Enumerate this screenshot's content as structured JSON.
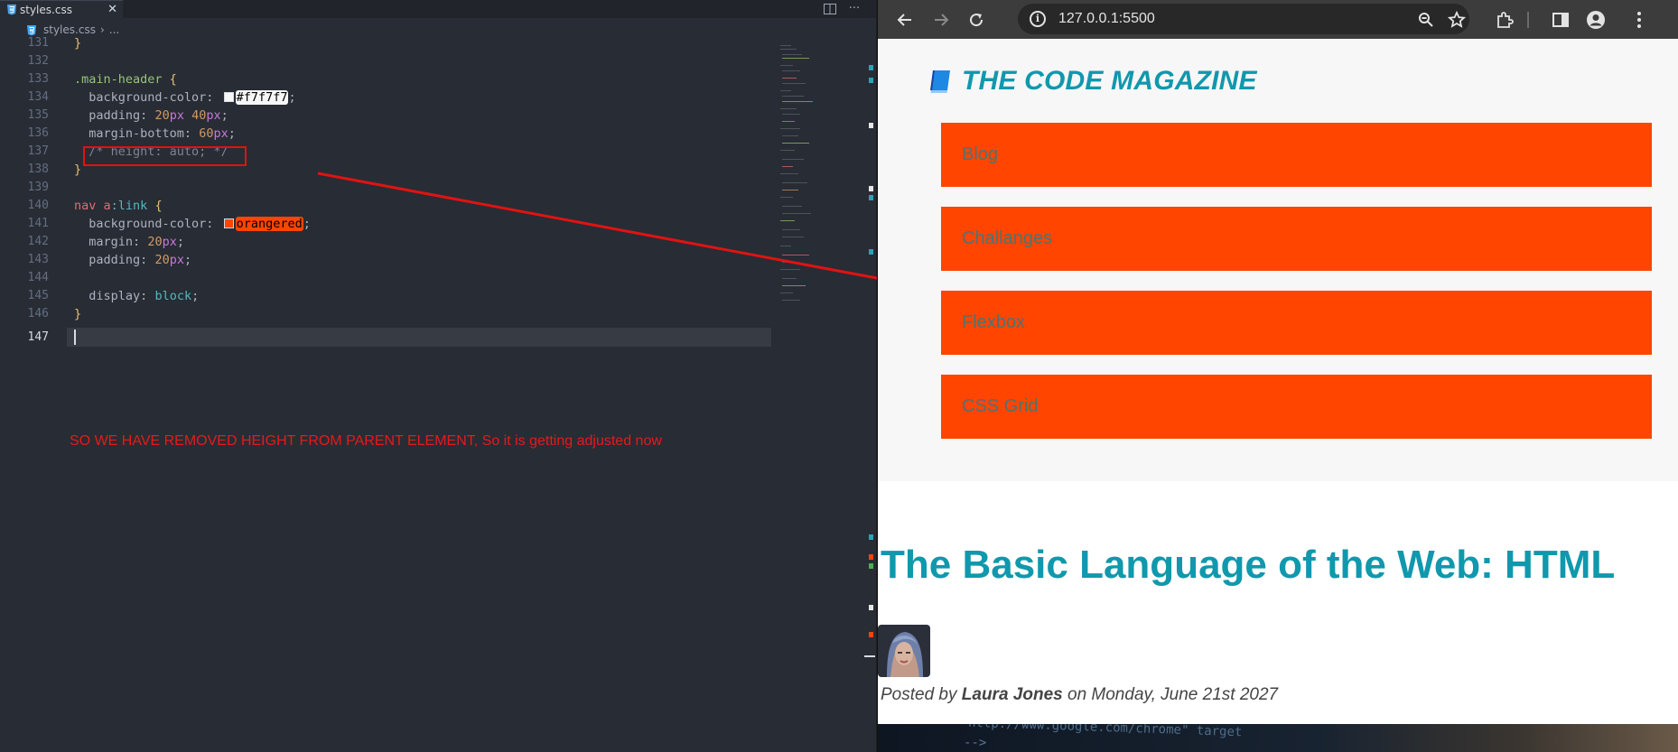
{
  "editor": {
    "tab_label": "styles.css",
    "tab_close": "✕",
    "breadcrumb_file": "styles.css",
    "breadcrumb_more": "...",
    "line_numbers": [
      "131",
      "132",
      "133",
      "134",
      "135",
      "136",
      "137",
      "138",
      "139",
      "140",
      "141",
      "142",
      "143",
      "144",
      "145",
      "146",
      "147"
    ],
    "active_line": "147",
    "code": {
      "l131_brace": "}",
      "l133_selector": ".main-header",
      "l133_brace": " {",
      "l134_prop": "background-color:",
      "l134_value": "#f7f7f7",
      "l134_semi": ";",
      "l135_prop": "padding:",
      "l135_n1": "20",
      "l135_u1": "px",
      "l135_n2": "40",
      "l135_u2": "px",
      "l135_semi": ";",
      "l136_prop": "margin-bottom:",
      "l136_n1": "60",
      "l136_u1": "px",
      "l136_semi": ";",
      "l137_comment": "/* height: auto; */",
      "l138_brace": "}",
      "l140_tag": "nav",
      "l140_elem": "a",
      "l140_pseudo": ":link",
      "l140_brace": " {",
      "l141_prop": "background-color:",
      "l141_value": "orangered",
      "l141_semi": ";",
      "l142_prop": "margin:",
      "l142_n1": "20",
      "l142_u1": "px",
      "l142_semi": ";",
      "l143_prop": "padding:",
      "l143_n1": "20",
      "l143_u1": "px",
      "l143_semi": ";",
      "l145_prop": "display:",
      "l145_value": "block",
      "l145_semi": ";",
      "l146_brace": "}"
    },
    "swatch_colors": {
      "main_header_bg": "#f7f7f7",
      "nav_link_bg": "#ff4500"
    },
    "annotation_note": "SO WE HAVE REMOVED HEIGHT FROM PARENT ELEMENT, So it is getting adjusted now"
  },
  "browser": {
    "url": "127.0.0.1:5500",
    "icons": [
      "back-icon",
      "forward-icon",
      "reload-icon",
      "site-info-icon",
      "zoom-icon",
      "bookmark-star-icon",
      "extensions-icon",
      "side-panel-icon",
      "profile-icon",
      "menu-icon"
    ]
  },
  "site": {
    "title": "THE CODE MAGAZINE",
    "nav_links": [
      "Blog",
      "Challanges",
      "Flexbox",
      "CSS Grid"
    ],
    "post_title": "The Basic Language of the Web: HTML",
    "meta_posted_by": "Posted by",
    "meta_author": "Laura Jones",
    "meta_date": "on Monday, June 21st 2027",
    "hero_code_line1": "http://www.google.com/chrome\" target",
    "hero_code_line2": "-->",
    "colors": {
      "accent": "#1098ad",
      "nav_bg": "#ff4500",
      "header_bg": "#f7f7f7"
    }
  }
}
